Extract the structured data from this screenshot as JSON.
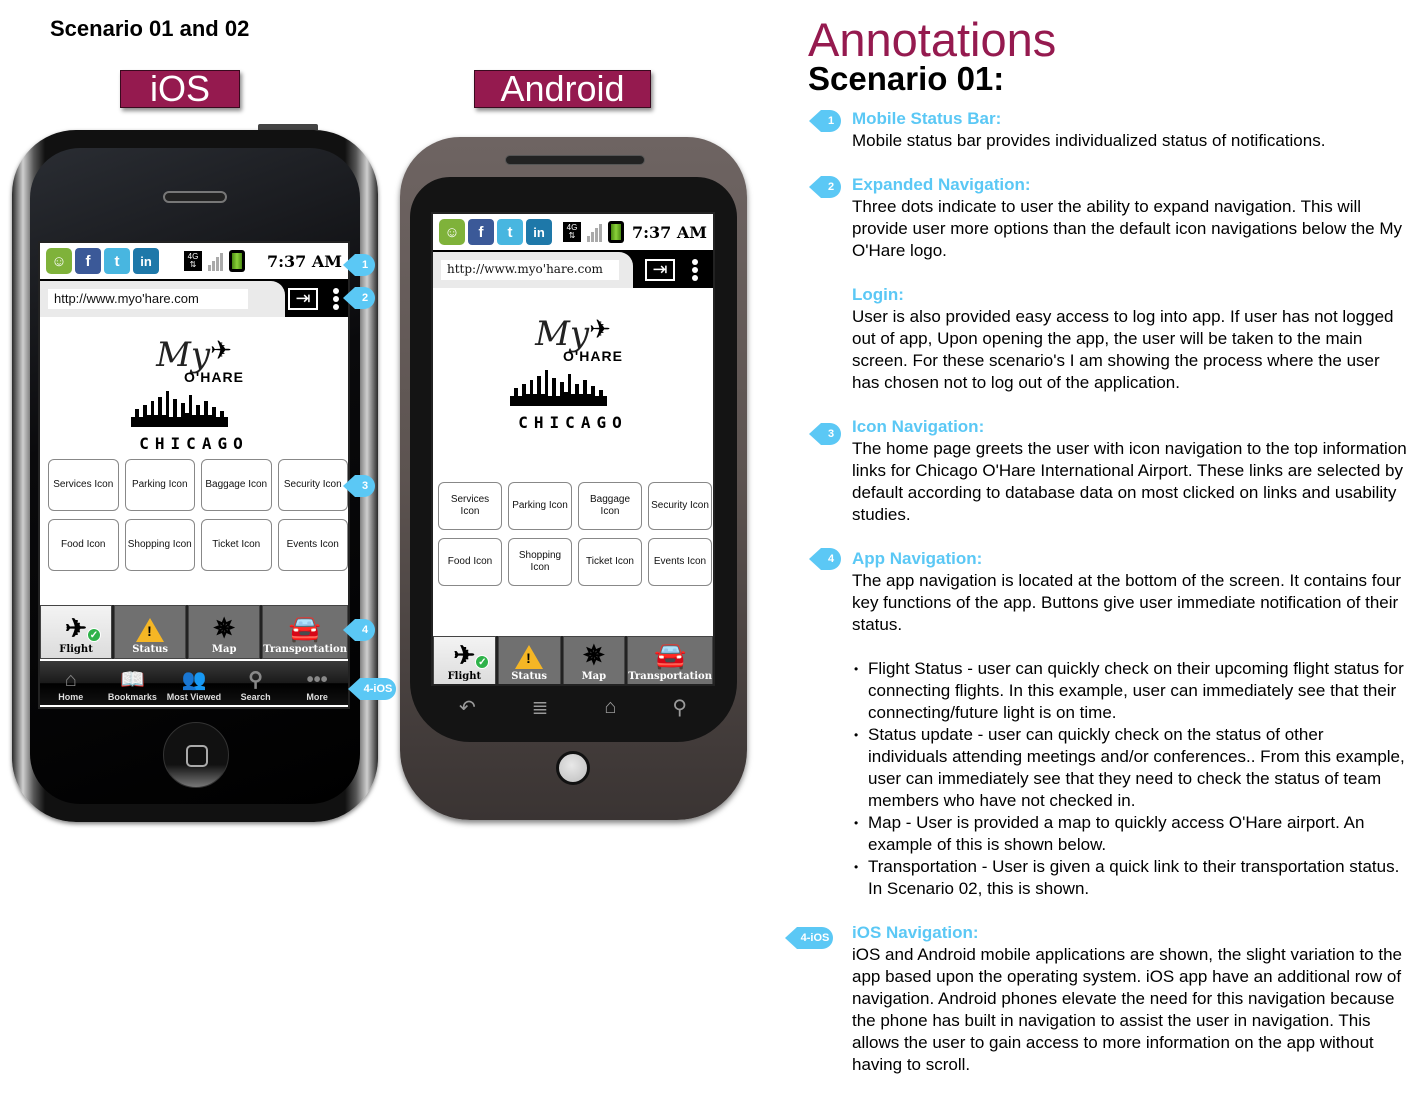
{
  "page_title": "Scenario 01 and 02",
  "labels": {
    "ios": "iOS",
    "android": "Android"
  },
  "accent_color": "#951a4f",
  "callout_color": "#5bc8f5",
  "status_bar": {
    "icons": [
      "message-icon",
      "facebook-icon",
      "twitter-icon",
      "linkedin-icon",
      "4g-icon",
      "signal-icon",
      "battery-icon"
    ],
    "fb": "f",
    "tw": "t",
    "li": "in",
    "net": "4G",
    "time": "7:37 AM"
  },
  "url_bar": {
    "url": "http://www.myo'hare.com",
    "go_icon": "⇥"
  },
  "logo": {
    "my": "My",
    "ohare": "O'HARE",
    "city": "CHICAGO"
  },
  "ios_tiles": [
    "Services Icon",
    "Parking Icon",
    "Baggage Icon",
    "Security Icon",
    "Food Icon",
    "Shopping Icon",
    "Ticket Icon",
    "Events Icon"
  ],
  "android_tiles": [
    "Services Icon",
    "Parking Icon",
    "Baggage Icon",
    "Security Icon",
    "Food Icon",
    "Shopping Icon",
    "Ticket Icon",
    "Events Icon"
  ],
  "app_nav": [
    {
      "label": "Flight",
      "active": true
    },
    {
      "label": "Status"
    },
    {
      "label": "Map"
    },
    {
      "label": "Transportation"
    }
  ],
  "ios_tabbar": [
    {
      "label": "Home"
    },
    {
      "label": "Bookmarks"
    },
    {
      "label": "Most Viewed"
    },
    {
      "label": "Search"
    },
    {
      "label": "More"
    }
  ],
  "callouts": {
    "c1": "1",
    "c2": "2",
    "c3": "3",
    "c4": "4",
    "c4ios": "4-iOS"
  },
  "annotations": {
    "title": "Annotations",
    "subtitle": "Scenario 01:",
    "items": [
      {
        "badge": "1",
        "heading": "Mobile Status Bar:",
        "text": "Mobile status bar provides individualized status of notifications."
      },
      {
        "badge": "2",
        "heading": "Expanded Navigation:",
        "text": "Three dots indicate to user the ability to expand navigation. This will provide user more options than the default icon navigations below the My O'Hare logo."
      },
      {
        "heading": "Login:",
        "text": "User is also provided easy access to log into app. If user has not logged out of app, Upon opening the app, the user will be taken to the main screen. For these scenario's I am showing the process where the user has chosen not to log out of the application."
      },
      {
        "badge": "3",
        "heading": "Icon Navigation:",
        "text": "The home page greets the user with icon navigation to the top information links for Chicago O'Hare International Airport. These links are selected by default according to database data on most clicked on links and usability studies."
      },
      {
        "badge": "4",
        "heading": "App Navigation:",
        "text": "The app navigation is located at the bottom of the screen. It contains four key functions of the app. Buttons give user immediate notification of their status.",
        "bullets": [
          "Flight Status - user can quickly check on their upcoming flight status for connecting flights. In this example, user can immediately see that their connecting/future light is on time.",
          "Status update - user can quickly check on the status of other individuals attending meetings and/or conferences.. From this example, user can immediately see that they need to check the status of team members who have not checked in.",
          "Map - User is provided a map to quickly access O'Hare airport.  An example of this is shown below.",
          "Transportation - User is given a quick link to their transportation status. In Scenario 02, this is shown."
        ]
      },
      {
        "badge": "4-iOS",
        "heading": "iOS Navigation:",
        "text": "iOS and Android mobile applications are shown, the slight variation to the app based upon the operating system. iOS app have an additional row of navigation. Android phones elevate the need for this navigation because the phone has built in navigation to assist the user in navigation. This allows the user to gain access to more information on the app without having to scroll."
      }
    ]
  }
}
